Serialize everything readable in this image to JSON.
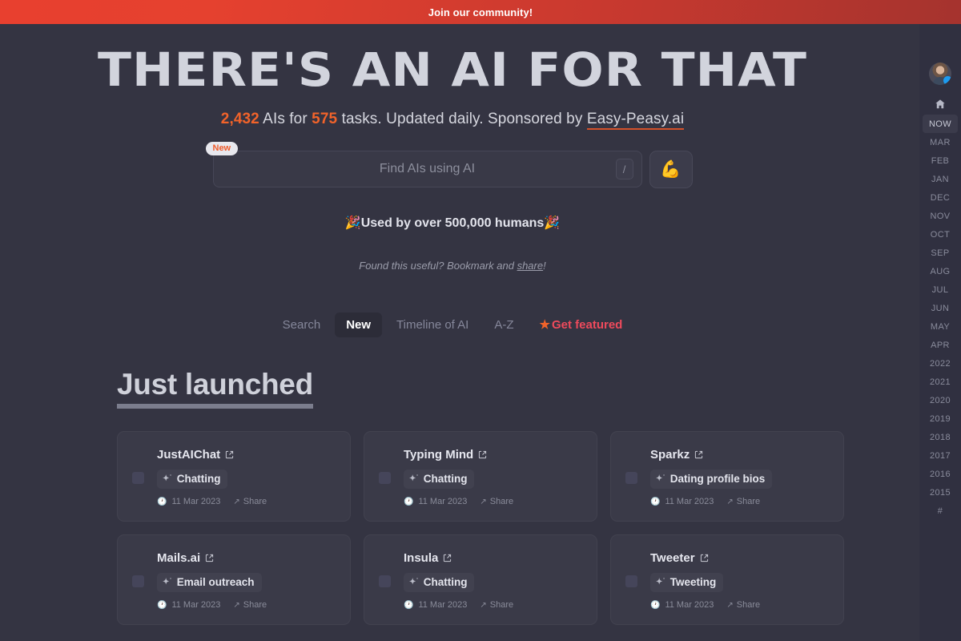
{
  "announcement": {
    "text": "Join our community!",
    "bg_color": "#e8402f"
  },
  "hero": {
    "title": "THERE'S AN AI FOR THAT",
    "subtitle": {
      "ai_count": "2,432",
      "mid_text": " AIs for ",
      "task_count": "575",
      "tail_text": " tasks. Updated daily. Sponsored by ",
      "sponsor": "Easy-Peasy.ai"
    },
    "accent_color": "#f2632a"
  },
  "search": {
    "new_badge": "New",
    "placeholder": "Find AIs using AI",
    "value": "",
    "shortcut_key": "/",
    "go_icon": "flexed-biceps-emoji",
    "go_glyph": "💪"
  },
  "social_proof": {
    "text": "🎉Used by over 500,000 humans🎉"
  },
  "bookmark": {
    "prefix": "Found this useful? Bookmark and ",
    "link": "share",
    "suffix": "!"
  },
  "tabs": [
    {
      "label": "Search",
      "active": false,
      "featured": false
    },
    {
      "label": "New",
      "active": true,
      "featured": false
    },
    {
      "label": "Timeline of AI",
      "active": false,
      "featured": false
    },
    {
      "label": "A-Z",
      "active": false,
      "featured": false
    },
    {
      "label": "Get featured",
      "active": false,
      "featured": true,
      "star": "★"
    }
  ],
  "section": {
    "title": "Just launched"
  },
  "cards": [
    {
      "name": "JustAIChat",
      "tag": "Chatting",
      "date": "11 Mar 2023",
      "share": "Share"
    },
    {
      "name": "Typing Mind",
      "tag": "Chatting",
      "date": "11 Mar 2023",
      "share": "Share"
    },
    {
      "name": "Sparkz",
      "tag": "Dating profile bios",
      "date": "11 Mar 2023",
      "share": "Share"
    },
    {
      "name": "Mails.ai",
      "tag": "Email outreach",
      "date": "11 Mar 2023",
      "share": "Share"
    },
    {
      "name": "Insula",
      "tag": "Chatting",
      "date": "11 Mar 2023",
      "share": "Share"
    },
    {
      "name": "Tweeter",
      "tag": "Tweeting",
      "date": "11 Mar 2023",
      "share": "Share"
    }
  ],
  "rail": {
    "avatar_icon": "user-avatar",
    "verified_icon": "twitter-verified-badge",
    "home_icon": "home-icon",
    "items": [
      {
        "label": "NOW",
        "active": true
      },
      {
        "label": "MAR",
        "active": false
      },
      {
        "label": "FEB",
        "active": false
      },
      {
        "label": "JAN",
        "active": false
      },
      {
        "label": "DEC",
        "active": false
      },
      {
        "label": "NOV",
        "active": false
      },
      {
        "label": "OCT",
        "active": false
      },
      {
        "label": "SEP",
        "active": false
      },
      {
        "label": "AUG",
        "active": false
      },
      {
        "label": "JUL",
        "active": false
      },
      {
        "label": "JUN",
        "active": false
      },
      {
        "label": "MAY",
        "active": false
      },
      {
        "label": "APR",
        "active": false
      },
      {
        "label": "2022",
        "active": false
      },
      {
        "label": "2021",
        "active": false
      },
      {
        "label": "2020",
        "active": false
      },
      {
        "label": "2019",
        "active": false
      },
      {
        "label": "2018",
        "active": false
      },
      {
        "label": "2017",
        "active": false
      },
      {
        "label": "2016",
        "active": false
      },
      {
        "label": "2015",
        "active": false
      },
      {
        "label": "#",
        "active": false
      }
    ]
  }
}
